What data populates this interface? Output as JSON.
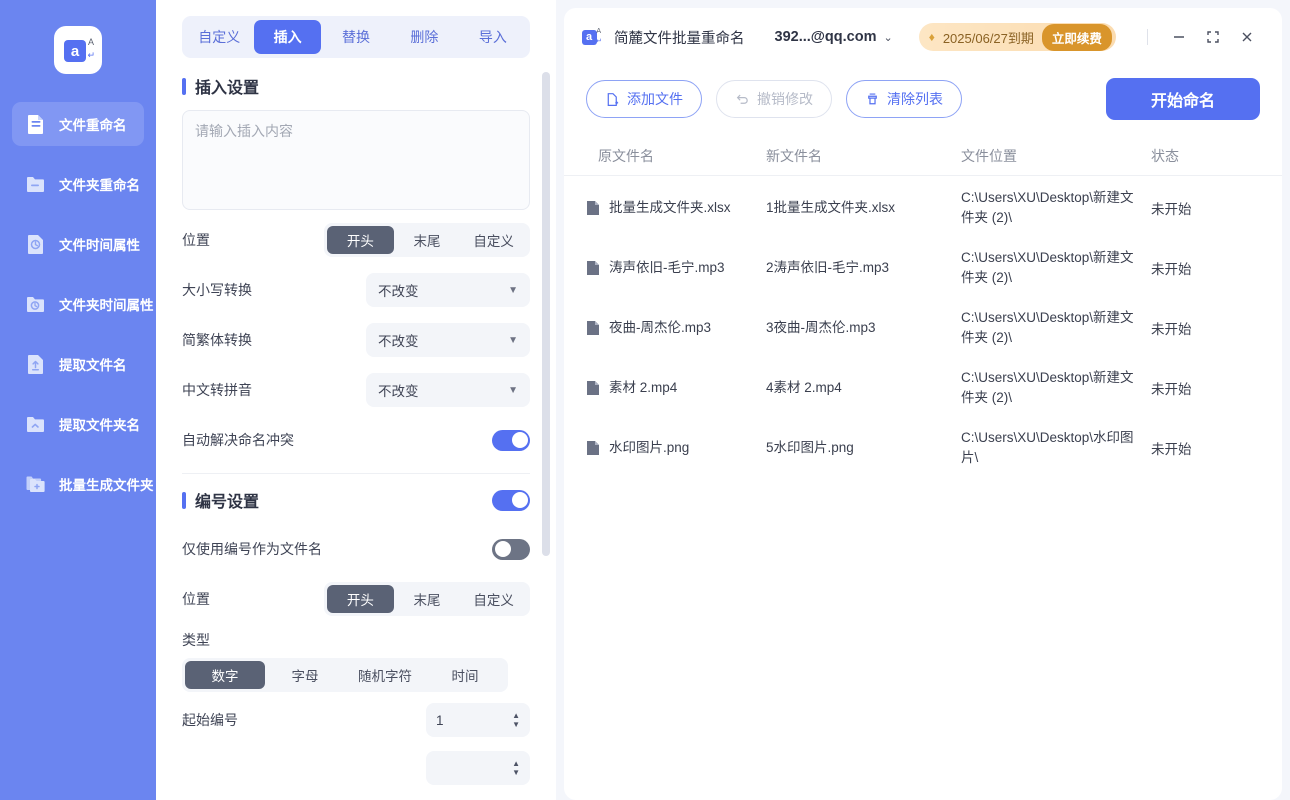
{
  "sidebar": {
    "logo": {
      "letter": "a",
      "sub": "A",
      "name": "app-logo"
    },
    "items": [
      {
        "label": "文件重命名",
        "icon": "file-rename-icon",
        "active": true
      },
      {
        "label": "文件夹重命名",
        "icon": "folder-rename-icon",
        "active": false
      },
      {
        "label": "文件时间属性",
        "icon": "file-time-icon",
        "active": false
      },
      {
        "label": "文件夹时间属性",
        "icon": "folder-time-icon",
        "active": false
      },
      {
        "label": "提取文件名",
        "icon": "extract-filename-icon",
        "active": false
      },
      {
        "label": "提取文件夹名",
        "icon": "extract-foldername-icon",
        "active": false
      },
      {
        "label": "批量生成文件夹",
        "icon": "batch-create-folder-icon",
        "active": false
      }
    ]
  },
  "settings": {
    "tabs": [
      {
        "label": "自定义",
        "active": false
      },
      {
        "label": "插入",
        "active": true
      },
      {
        "label": "替换",
        "active": false
      },
      {
        "label": "删除",
        "active": false
      },
      {
        "label": "导入",
        "active": false
      }
    ],
    "insert_section": {
      "title": "插入设置",
      "textarea_placeholder": "请输入插入内容",
      "textarea_value": "",
      "position": {
        "label": "位置",
        "options": [
          "开头",
          "末尾",
          "自定义"
        ],
        "selected": "开头"
      },
      "case_convert": {
        "label": "大小写转换",
        "value": "不改变"
      },
      "trad_simp_convert": {
        "label": "简繁体转换",
        "value": "不改变"
      },
      "pinyin_convert": {
        "label": "中文转拼音",
        "value": "不改变"
      },
      "auto_resolve_conflict": {
        "label": "自动解决命名冲突",
        "on": true
      }
    },
    "number_section": {
      "title": "编号设置",
      "enabled": true,
      "only_number_as_name": {
        "label": "仅使用编号作为文件名",
        "on": false
      },
      "position": {
        "label": "位置",
        "options": [
          "开头",
          "末尾",
          "自定义"
        ],
        "selected": "开头"
      },
      "type": {
        "label": "类型",
        "options": [
          "数字",
          "字母",
          "随机字符",
          "时间"
        ],
        "selected": "数字"
      },
      "start_number": {
        "label": "起始编号",
        "value": "1"
      }
    }
  },
  "titlebar": {
    "app_name": "简麓文件批量重命名",
    "account": "392...@qq.com",
    "vip_expiry": "2025/06/27到期",
    "renew_button": "立即续费",
    "minimize": "minimize-icon",
    "maximize": "maximize-icon",
    "close": "close-icon"
  },
  "toolbar": {
    "add_file": "添加文件",
    "undo": "撤销修改",
    "clear_list": "清除列表",
    "start_rename": "开始命名"
  },
  "table": {
    "headers": [
      "原文件名",
      "新文件名",
      "文件位置",
      "状态"
    ],
    "rows": [
      {
        "original": "批量生成文件夹.xlsx",
        "new": "1批量生成文件夹.xlsx",
        "location": "C:\\Users\\XU\\Desktop\\新建文件夹 (2)\\",
        "status": "未开始"
      },
      {
        "original": "涛声依旧-毛宁.mp3",
        "new": "2涛声依旧-毛宁.mp3",
        "location": "C:\\Users\\XU\\Desktop\\新建文件夹 (2)\\",
        "status": "未开始"
      },
      {
        "original": "夜曲-周杰伦.mp3",
        "new": "3夜曲-周杰伦.mp3",
        "location": "C:\\Users\\XU\\Desktop\\新建文件夹 (2)\\",
        "status": "未开始"
      },
      {
        "original": "素材 2.mp4",
        "new": "4素材 2.mp4",
        "location": "C:\\Users\\XU\\Desktop\\新建文件夹 (2)\\",
        "status": "未开始"
      },
      {
        "original": "水印图片.png",
        "new": "5水印图片.png",
        "location": "C:\\Users\\XU\\Desktop\\水印图片\\",
        "status": "未开始"
      }
    ]
  },
  "colors": {
    "sidebar_bg": "#6b85f0",
    "accent": "#5570f1",
    "segment_active": "#5a6275",
    "vip_gold": "#d9952b",
    "panel_bg": "#f4f6fb"
  }
}
